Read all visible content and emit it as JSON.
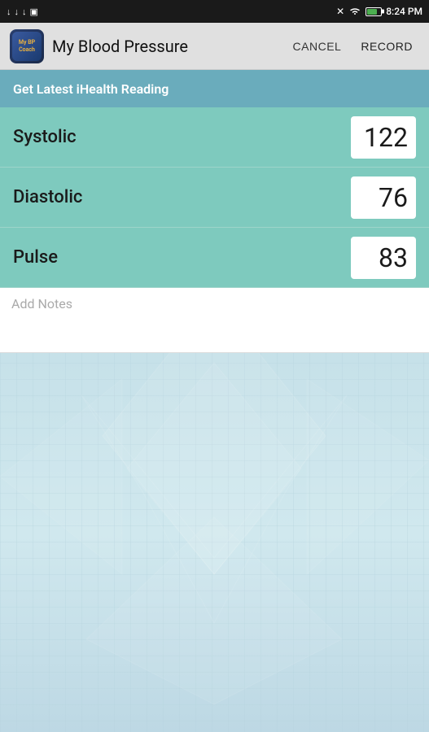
{
  "statusBar": {
    "time": "8:24 PM",
    "icons": {
      "noSignal": "✕",
      "wifi": "wifi",
      "battery": "battery"
    }
  },
  "actionBar": {
    "appTitle": "My Blood Pressure",
    "cancelLabel": "CANCEL",
    "recordLabel": "RECORD"
  },
  "iHealthBanner": {
    "text": "Get Latest iHealth Reading"
  },
  "readings": [
    {
      "label": "Systolic",
      "value": "122"
    },
    {
      "label": "Diastolic",
      "value": "76"
    },
    {
      "label": "Pulse",
      "value": "83"
    }
  ],
  "notes": {
    "placeholder": "Add Notes"
  }
}
